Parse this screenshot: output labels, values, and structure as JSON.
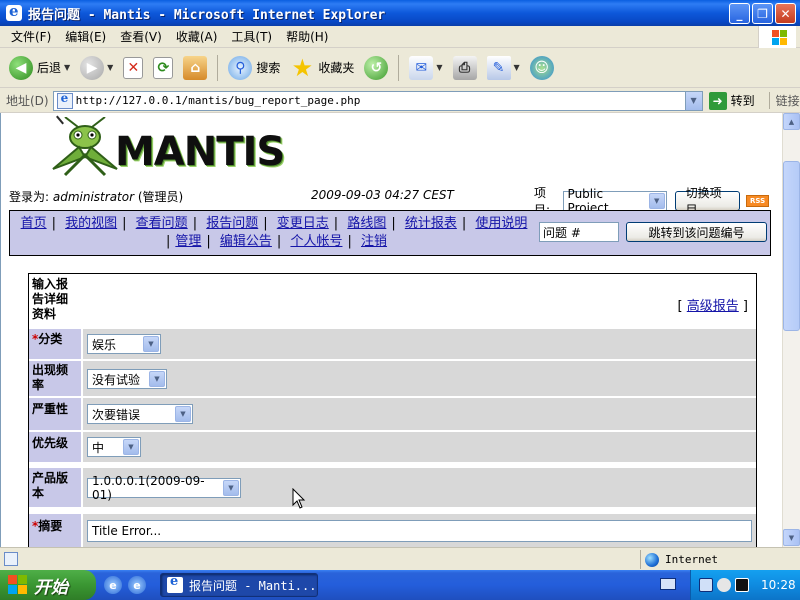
{
  "window": {
    "title": "报告问题 - Mantis - Microsoft Internet Explorer"
  },
  "menu": [
    "文件(F)",
    "编辑(E)",
    "查看(V)",
    "收藏(A)",
    "工具(T)",
    "帮助(H)"
  ],
  "toolbar": {
    "back": "后退",
    "search": "搜索",
    "favorites": "收藏夹"
  },
  "address": {
    "label": "地址(D)",
    "url": "http://127.0.0.1/mantis/bug_report_page.php",
    "go": "转到",
    "links": "链接"
  },
  "page": {
    "logo_text": "MANTIS",
    "login_label": "登录为:",
    "user": "administrator",
    "role": "(管理员)",
    "datetime": "2009-09-03 04:27 CEST",
    "project_label": "项目:",
    "project_value": "Public Project",
    "switch_button": "切换项目",
    "rss": "RSS",
    "nav": [
      "首页",
      "我的视图",
      "查看问题",
      "报告问题",
      "变更日志",
      "路线图",
      "统计报表",
      "使用说明",
      "管理",
      "编辑公告",
      "个人帐号",
      "注销"
    ],
    "issue_jump_value": "问题 #",
    "issue_jump_button": "跳转到该问题编号"
  },
  "form": {
    "heading": "输入报告详细资料",
    "advanced_link": "高级报告",
    "category_label": "分类",
    "category_value": "娱乐",
    "frequency_label": "出现频率",
    "frequency_value": "没有试验",
    "severity_label": "严重性",
    "severity_value": "次要错误",
    "priority_label": "优先级",
    "priority_value": "中",
    "version_label": "产品版本",
    "version_value": "1.0.0.0.1(2009-09-01)",
    "summary_label": "摘要",
    "summary_value": "Title Error..."
  },
  "statusbar": {
    "zone": "Internet"
  },
  "taskbar": {
    "start": "开始",
    "task": "报告问题 - Manti...",
    "clock": "10:28"
  }
}
